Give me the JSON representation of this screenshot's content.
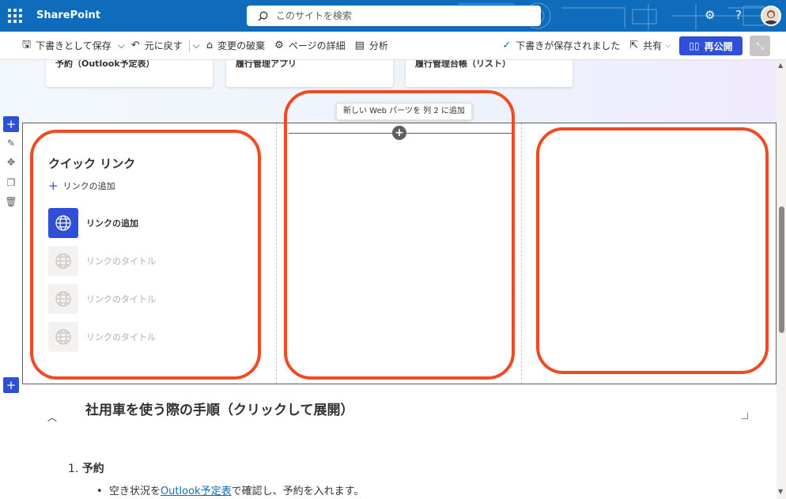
{
  "suite": {
    "brand": "SharePoint",
    "search_placeholder": "このサイトを検索"
  },
  "commands": {
    "save_draft": "下書きとして保存",
    "undo": "元に戻す",
    "discard": "変更の破棄",
    "page_details": "ページの詳細",
    "analytics": "分析",
    "draft_saved": "下書きが保存されました",
    "share": "共有",
    "republish": "再公開"
  },
  "hero_cards": [
    {
      "label": "予約（Outlook予定表）"
    },
    {
      "label": "履行管理アプリ"
    },
    {
      "label": "履行管理台帳（リスト）"
    }
  ],
  "section": {
    "tooltip": "新しい Web パーツを 列 2 に追加",
    "quick_links": {
      "title": "クイック リンク",
      "add_link": "リンクの追加",
      "items": [
        {
          "label": "リンクの追加",
          "active": true
        },
        {
          "label": "リンクのタイトル",
          "active": false
        },
        {
          "label": "リンクのタイトル",
          "active": false
        },
        {
          "label": "リンクのタイトル",
          "active": false
        }
      ]
    }
  },
  "content": {
    "heading": "社用車を使う際の手順（クリックして展開）",
    "list_number": "1.",
    "list_item": "予約",
    "bullet_pre": "空き状況を",
    "bullet_link": "Outlook予定表",
    "bullet_post": "で確認し、予約を入れます。"
  },
  "colors": {
    "suite_bar": "#0f6cbd",
    "accent": "#2f4fd6",
    "highlight": "#f04a24"
  }
}
